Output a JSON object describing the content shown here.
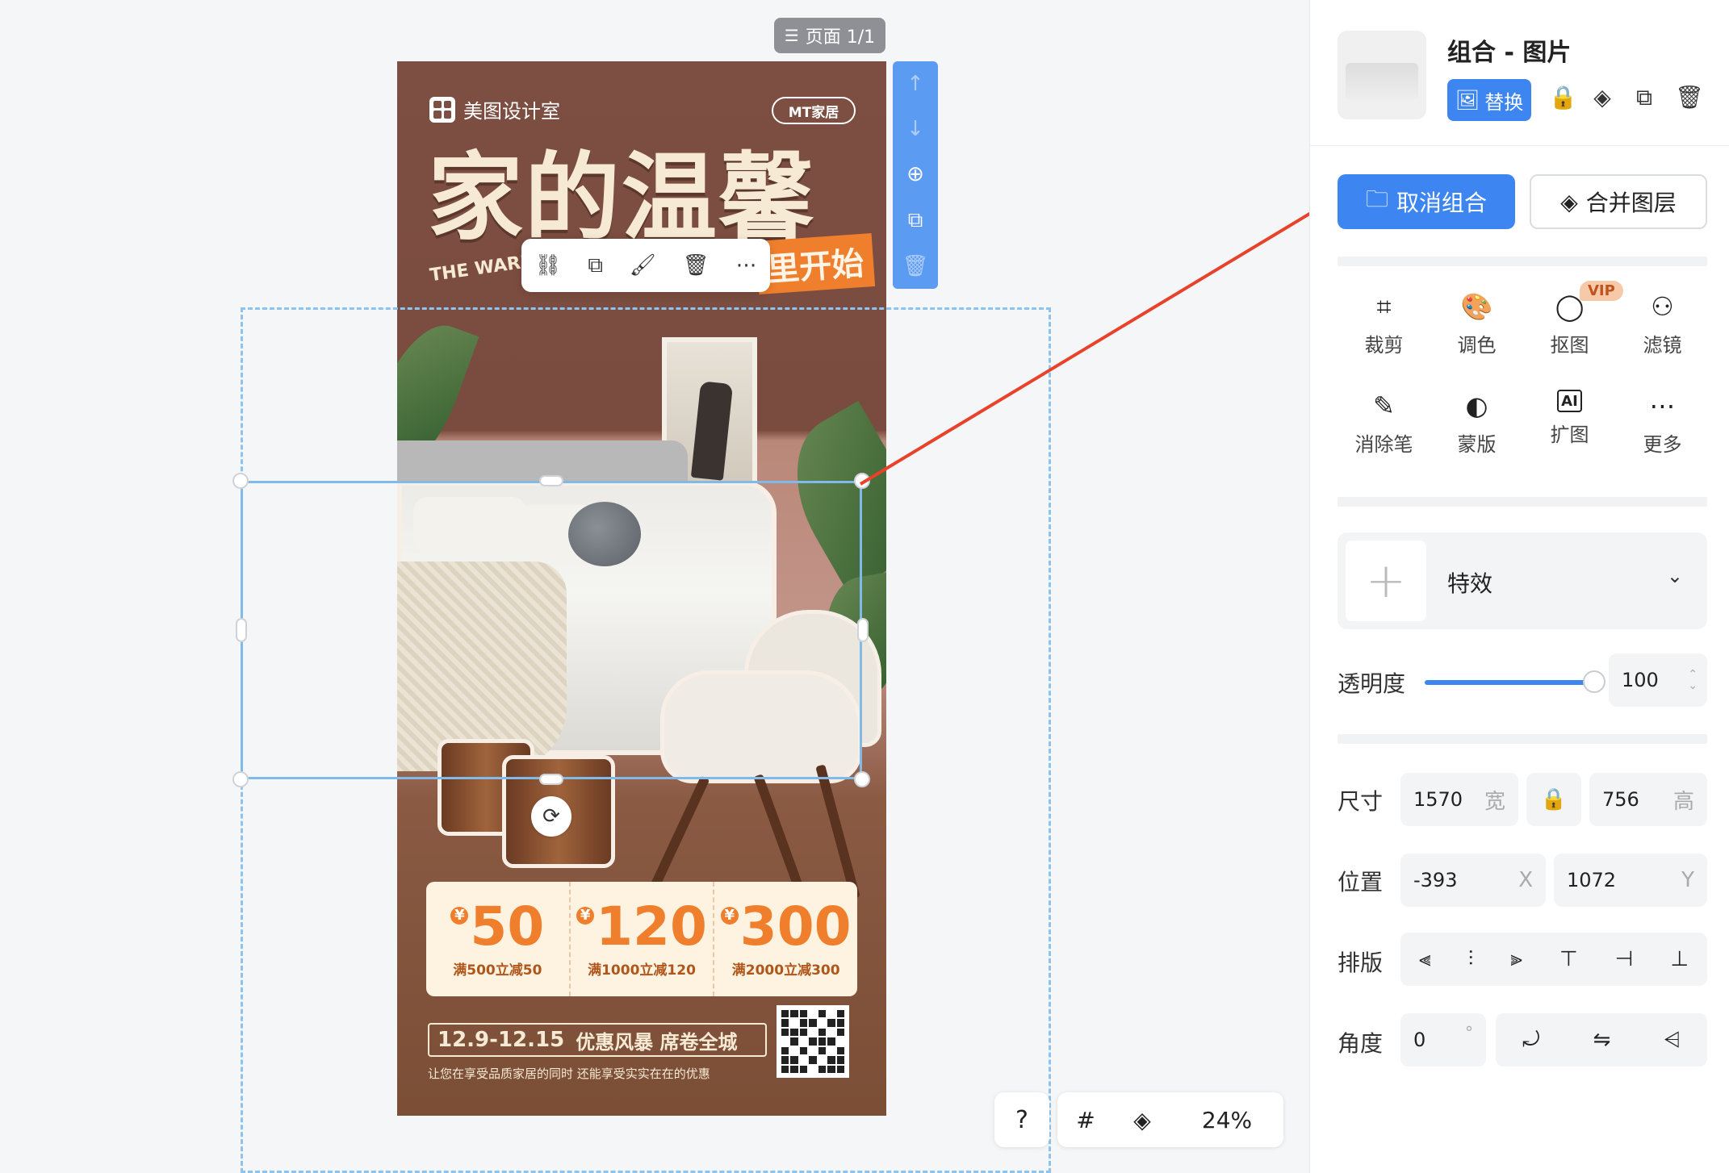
{
  "canvas": {
    "page_indicator": "页面 1/1",
    "zoom": "24%"
  },
  "poster": {
    "brand": "美图设计室",
    "mt_badge": "MT家居",
    "title": "家的温馨",
    "subtitle_en": "THE WARM",
    "tag": "里开始",
    "coupons": [
      {
        "currency": "¥",
        "amount": "50",
        "condition": "满500立减50"
      },
      {
        "currency": "¥",
        "amount": "120",
        "condition": "满1000立减120"
      },
      {
        "currency": "¥",
        "amount": "300",
        "condition": "满2000立减300"
      }
    ],
    "date_range": "12.9-12.15",
    "promo": "优惠风暴 席卷全城",
    "fine_print": "让您在享受品质家居的同时 还能享受实实在在的优惠"
  },
  "float_toolbar": {
    "icons": [
      "unlink-icon",
      "duplicate-icon",
      "format-painter-icon",
      "trash-icon",
      "more-icon"
    ]
  },
  "side_arrange": {
    "icons": [
      "arrow-up-icon",
      "arrow-down-icon",
      "add-circle-icon",
      "duplicate-icon",
      "trash-icon"
    ]
  },
  "panel": {
    "title": "组合 - 图片",
    "replace_label": "替换",
    "ungroup_label": "取消组合",
    "merge_label": "合并图层",
    "tools": [
      {
        "label": "裁剪",
        "icon": "crop-icon"
      },
      {
        "label": "调色",
        "icon": "palette-icon"
      },
      {
        "label": "抠图",
        "icon": "cutout-icon",
        "badge": "VIP"
      },
      {
        "label": "滤镜",
        "icon": "filter-icon"
      },
      {
        "label": "消除笔",
        "icon": "eraser-icon"
      },
      {
        "label": "蒙版",
        "icon": "mask-icon"
      },
      {
        "label": "扩图",
        "icon": "ai-expand-icon",
        "icon_text": "AI"
      },
      {
        "label": "更多",
        "icon": "more-icon"
      }
    ],
    "effects_label": "特效",
    "opacity_label": "透明度",
    "opacity_value": "100",
    "opacity_fraction": 1.0,
    "size_label": "尺寸",
    "width_value": "1570",
    "width_suffix": "宽",
    "height_value": "756",
    "height_suffix": "高",
    "position_label": "位置",
    "x_value": "-393",
    "x_suffix": "X",
    "y_value": "1072",
    "y_suffix": "Y",
    "layout_label": "排版",
    "angle_label": "角度",
    "angle_value": "0",
    "angle_suffix": "°"
  },
  "colors": {
    "accent": "#3d86f2",
    "poster_brown": "#7d4f42",
    "coupon_orange": "#ef7f2c",
    "annotation_arrow": "#e8422b"
  }
}
